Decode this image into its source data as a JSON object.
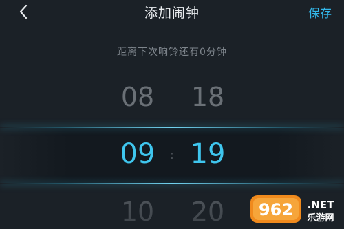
{
  "header": {
    "title": "添加闹钟",
    "save_label": "保存"
  },
  "countdown_text": "距离下次响铃还有0分钟",
  "picker": {
    "hours": {
      "above": "08",
      "selected": "09",
      "below": "10"
    },
    "minutes": {
      "above": "18",
      "selected": "19",
      "below": "20"
    },
    "separator": ":"
  },
  "colors": {
    "background": "#1b2127",
    "accent": "#3fc6ee",
    "save": "#33b8ea",
    "muted_text": "#7e858c"
  },
  "watermark": {
    "logo_text": "962",
    "net_text": ".NET",
    "site_text": "乐游网"
  },
  "icons": {
    "back": "chevron-left-icon"
  }
}
